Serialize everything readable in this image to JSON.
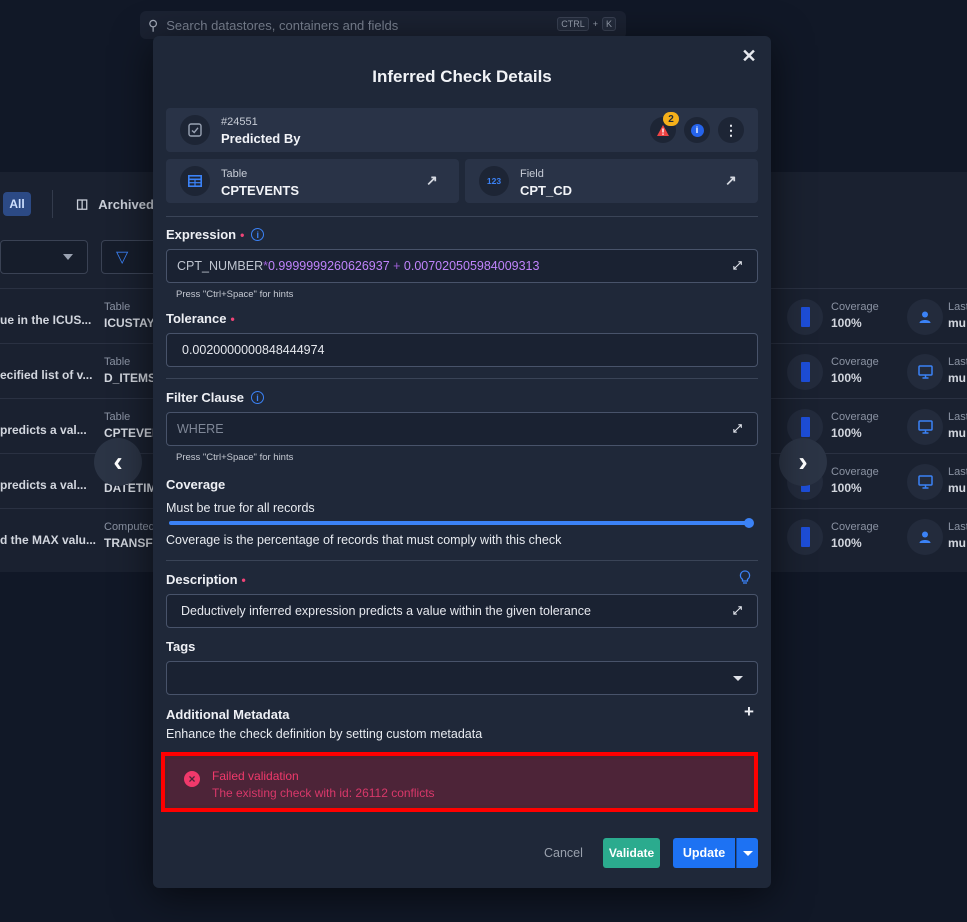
{
  "search": {
    "placeholder": "Search datastores, containers and fields",
    "shortcut_ctrl": "CTRL",
    "shortcut_plus": "+",
    "shortcut_key": "K"
  },
  "background": {
    "filter_all": "All",
    "archived_label": "Archived",
    "rows": [
      {
        "name": "ue in the ICUS...",
        "type_label": "Table",
        "type_value": "ICUSTAYS",
        "coverage_label": "Coverage",
        "coverage_value": "100%",
        "last_label": "Last",
        "last_value": "mu",
        "user_icon": "person-icon"
      },
      {
        "name": "ecified list of v...",
        "type_label": "Table",
        "type_value": "D_ITEMS",
        "coverage_label": "Coverage",
        "coverage_value": "100%",
        "last_label": "Last",
        "last_value": "mu",
        "user_icon": "monitor-icon"
      },
      {
        "name": "predicts a val...",
        "type_label": "Table",
        "type_value": "CPTEVEN",
        "coverage_label": "Coverage",
        "coverage_value": "100%",
        "last_label": "Last",
        "last_value": "mu",
        "user_icon": "monitor-icon"
      },
      {
        "name": "predicts a val...",
        "type_label": "",
        "type_value": "DATETIM",
        "coverage_label": "Coverage",
        "coverage_value": "100%",
        "last_label": "Last",
        "last_value": "mu",
        "user_icon": "monitor-icon"
      },
      {
        "name": "d the MAX valu...",
        "type_label": "Computed",
        "type_value": "TRANSFE",
        "coverage_label": "Coverage",
        "coverage_value": "100%",
        "last_label": "Last",
        "last_value": "mu",
        "user_icon": "person-icon"
      }
    ]
  },
  "modal": {
    "title": "Inferred Check Details",
    "check": {
      "id": "#24551",
      "predicted_by": "Predicted By",
      "alert_count": "2"
    },
    "table_card": {
      "label": "Table",
      "value": "CPTEVENTS"
    },
    "field_card": {
      "label": "Field",
      "value": "CPT_CD"
    },
    "expression": {
      "label": "Expression",
      "var": "CPT_NUMBER",
      "op1": "*",
      "num1": "0.9999999260626937",
      "op2": " + ",
      "num2": "0.007020505984009313",
      "hint": "Press \"Ctrl+Space\" for hints"
    },
    "tolerance": {
      "label": "Tolerance",
      "value": "0.0020000000848444974"
    },
    "filter_clause": {
      "label": "Filter Clause",
      "placeholder": "WHERE",
      "hint": "Press \"Ctrl+Space\" for hints"
    },
    "coverage": {
      "label": "Coverage",
      "subtitle": "Must be true for all records",
      "value": 1.0,
      "help": "Coverage is the percentage of records that must comply with this check"
    },
    "description": {
      "label": "Description",
      "value": "Deductively inferred expression predicts a value within the given tolerance"
    },
    "tags": {
      "label": "Tags"
    },
    "metadata": {
      "label": "Additional Metadata",
      "help": "Enhance the check definition by setting custom metadata"
    },
    "error": {
      "title": "Failed validation",
      "message": "The existing check with id: 26112 conflicts"
    },
    "buttons": {
      "cancel": "Cancel",
      "validate": "Validate",
      "update": "Update"
    }
  },
  "colors": {
    "accent": "#3b82f6",
    "validate": "#2bab8e",
    "update": "#1d72f3",
    "error": "#f0396b",
    "highlight_border": "#ff0000"
  }
}
